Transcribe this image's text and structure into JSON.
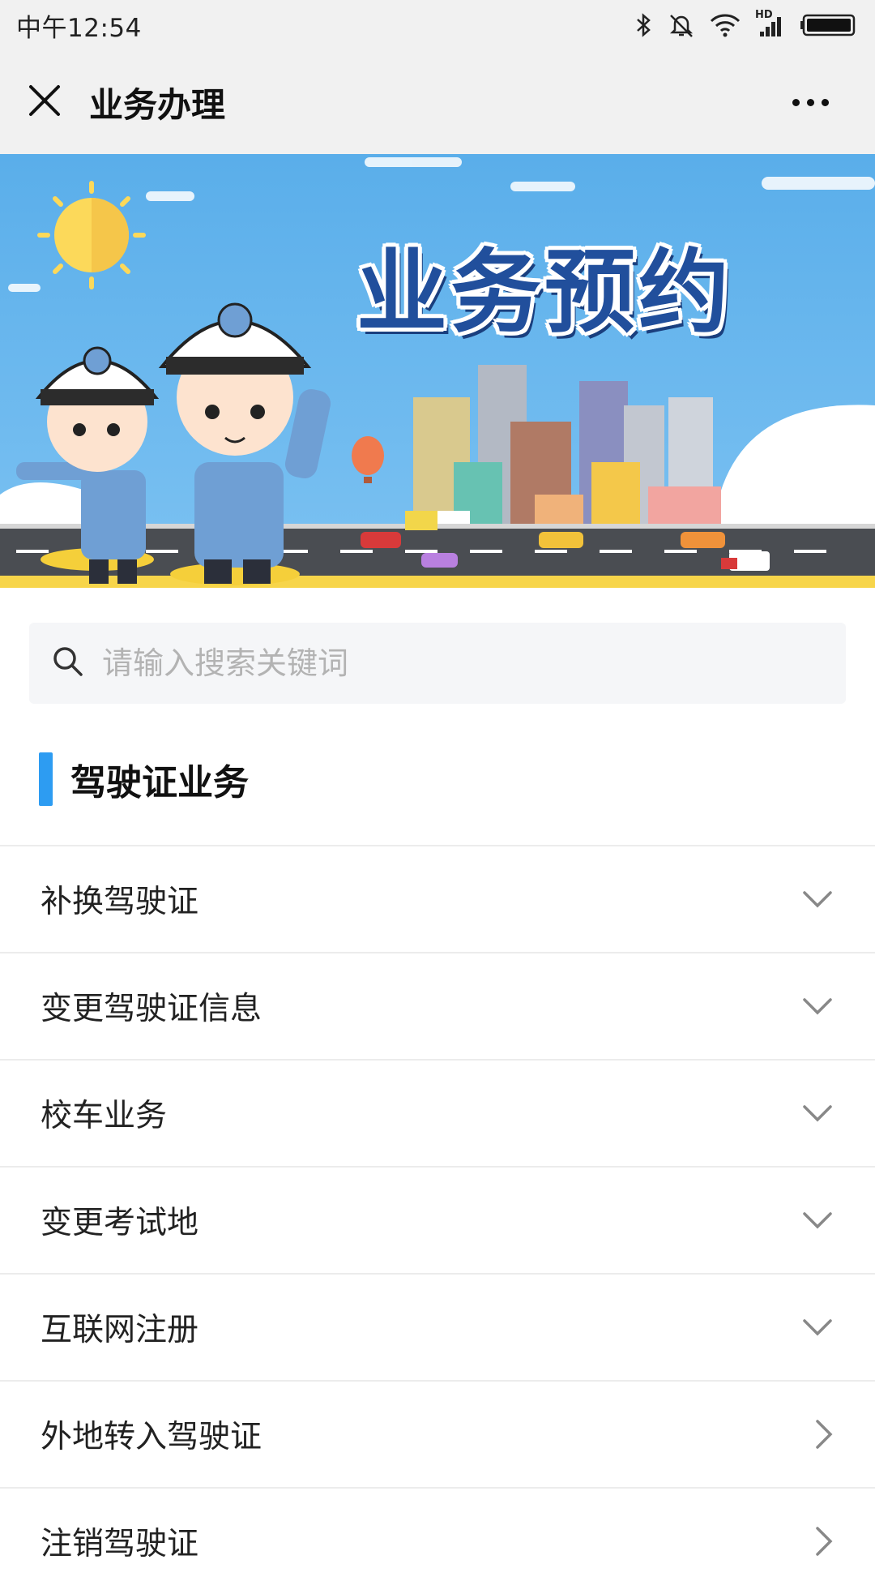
{
  "status_bar": {
    "time": "中午12:54",
    "hd_label": "HD"
  },
  "header": {
    "title": "业务办理"
  },
  "banner": {
    "title": "业务预约"
  },
  "search": {
    "placeholder": "请输入搜索关键词",
    "value": ""
  },
  "section": {
    "title": "驾驶证业务",
    "accent_color": "#2d9cf2"
  },
  "items": [
    {
      "label": "补换驾驶证",
      "icon": "chevron-down-icon"
    },
    {
      "label": "变更驾驶证信息",
      "icon": "chevron-down-icon"
    },
    {
      "label": "校车业务",
      "icon": "chevron-down-icon"
    },
    {
      "label": "变更考试地",
      "icon": "chevron-down-icon"
    },
    {
      "label": "互联网注册",
      "icon": "chevron-down-icon"
    },
    {
      "label": "外地转入驾驶证",
      "icon": "chevron-right-icon"
    },
    {
      "label": "注销驾驶证",
      "icon": "chevron-right-icon"
    }
  ]
}
